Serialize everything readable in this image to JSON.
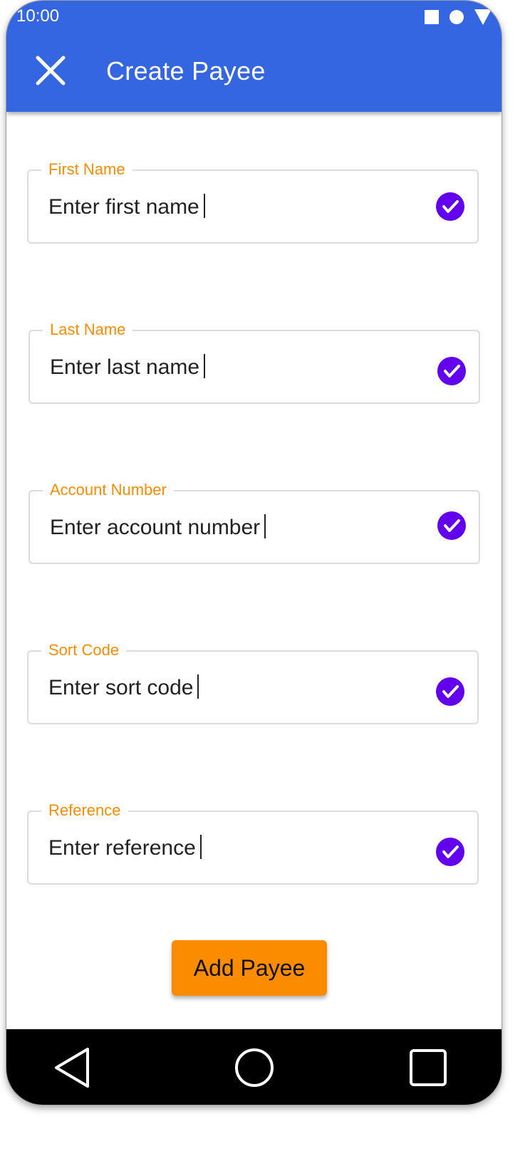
{
  "status_bar": {
    "time": "10:00",
    "icons": [
      "square-icon",
      "circle-icon",
      "triangle-icon"
    ]
  },
  "app_bar": {
    "title": "Create Payee",
    "close_icon": "close-icon",
    "color": "#3366e0"
  },
  "form": {
    "fields": [
      {
        "label": "First Name",
        "placeholder": "Enter first name"
      },
      {
        "label": "Last Name",
        "placeholder": "Enter last name"
      },
      {
        "label": "Account Number",
        "placeholder": "Enter account number"
      },
      {
        "label": "Sort Code",
        "placeholder": "Enter sort code"
      },
      {
        "label": "Reference",
        "placeholder": "Enter reference"
      }
    ],
    "label_color": "#fb8c00",
    "check_color": "#6200ee"
  },
  "actions": {
    "add_payee_label": "Add Payee",
    "button_color": "#fb8c00"
  },
  "nav_bar": {
    "items": [
      "back-icon",
      "home-icon",
      "recents-icon"
    ]
  }
}
